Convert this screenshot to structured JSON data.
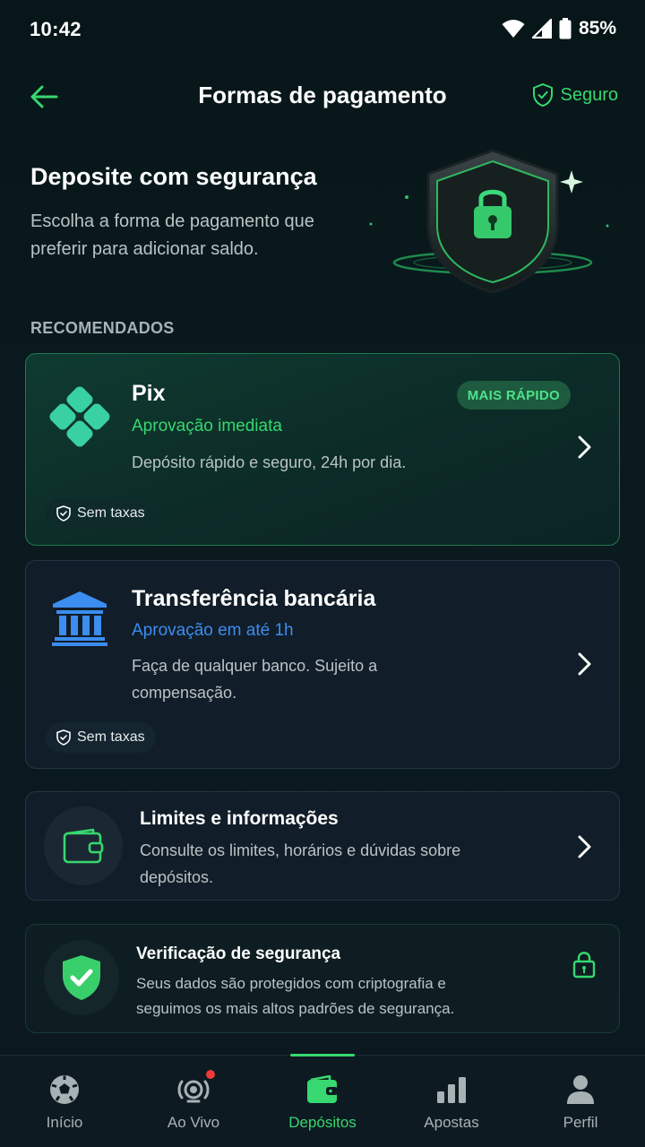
{
  "status_bar": {
    "time": "10:42",
    "battery": "85%"
  },
  "header": {
    "title": "Formas de pagamento",
    "secure_label": "Seguro"
  },
  "hero": {
    "title": "Deposite com segurança",
    "subtitle": "Escolha a forma de pagamento que preferir para adicionar saldo."
  },
  "section_label": "RECOMENDADOS",
  "methods": [
    {
      "name": "Pix",
      "approval": "Aprovação imediata",
      "description": "Depósito rápido e seguro, 24h por dia.",
      "badge": "MAIS RÁPIDO",
      "fee": "Sem taxas",
      "approval_color": "#36d86f"
    },
    {
      "name": "Transferência bancária",
      "approval": "Aprovação em até 1h",
      "description": "Faça de qualquer banco. Sujeito a compensação.",
      "fee": "Sem taxas",
      "approval_color": "#3b8df0"
    }
  ],
  "limits": {
    "title": "Limites e informações",
    "description": "Consulte os limites, horários e dúvidas sobre depósitos."
  },
  "security": {
    "title": "Verificação de segurança",
    "description": "Seus dados são protegidos com criptografia e seguimos os mais altos padrões de segurança."
  },
  "nav": {
    "items": [
      {
        "label": "Início",
        "icon": "soccer-ball-icon"
      },
      {
        "label": "Ao Vivo",
        "icon": "live-icon"
      },
      {
        "label": "Depósitos",
        "icon": "wallet-icon"
      },
      {
        "label": "Apostas",
        "icon": "bar-chart-icon"
      },
      {
        "label": "Perfil",
        "icon": "person-icon"
      }
    ],
    "active_index": 2
  },
  "colors": {
    "accent": "#36d86f",
    "blue": "#3b8df0",
    "background": "#0a1a1f"
  }
}
